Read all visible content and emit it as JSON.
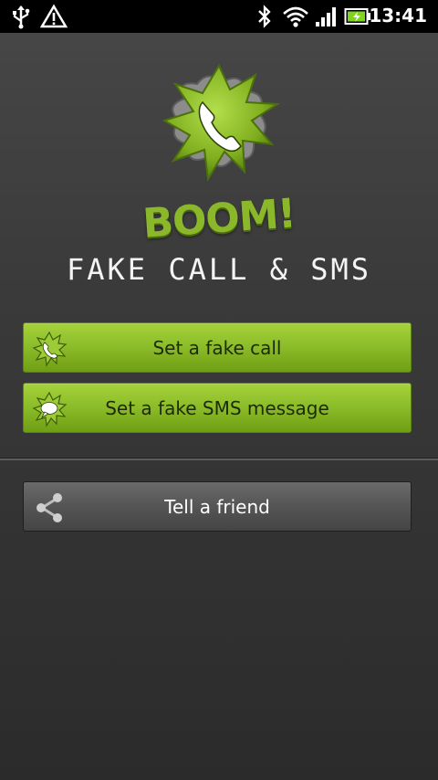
{
  "status_bar": {
    "time": "13:41",
    "icons": [
      "usb-icon",
      "warning-icon",
      "bluetooth-icon",
      "wifi-icon",
      "signal-icon",
      "battery-charging-icon"
    ],
    "battery_color": "#7fd51d"
  },
  "app": {
    "logo_word": "BOOM!",
    "subtitle": "FAKE CALL & SMS",
    "accent": "#8ab82a"
  },
  "buttons": {
    "fake_call": "Set a fake call",
    "fake_sms": "Set a fake SMS message",
    "tell_friend": "Tell a friend"
  }
}
